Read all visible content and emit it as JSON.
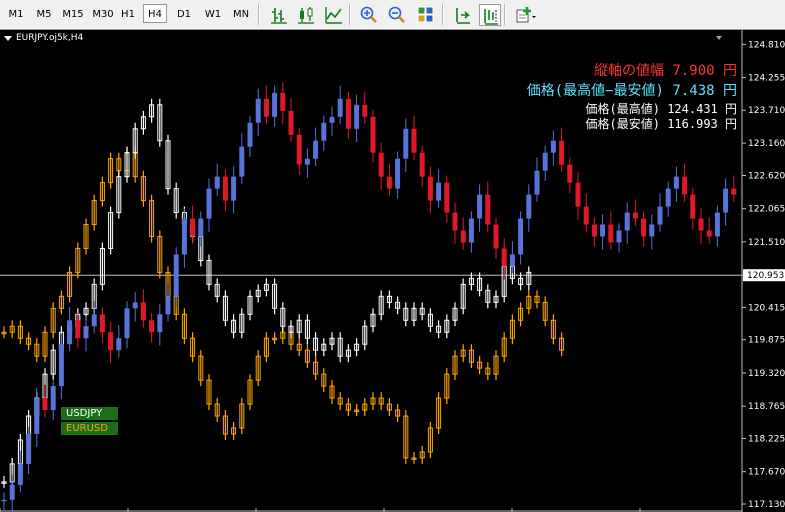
{
  "toolbar": {
    "timeframes": [
      {
        "label": "M1",
        "active": false
      },
      {
        "label": "M5",
        "active": false
      },
      {
        "label": "M15",
        "active": false
      },
      {
        "label": "M30",
        "active": false
      },
      {
        "label": "H1",
        "active": false
      },
      {
        "label": "H4",
        "active": true
      },
      {
        "label": "D1",
        "active": false
      },
      {
        "label": "W1",
        "active": false
      },
      {
        "label": "MN",
        "active": false
      }
    ],
    "tools": [
      {
        "name": "bar-chart-icon",
        "active": false
      },
      {
        "name": "candlestick-chart-icon",
        "active": false
      },
      {
        "name": "line-chart-icon",
        "active": false
      },
      {
        "name": "zoom-in-icon",
        "active": false
      },
      {
        "name": "zoom-out-icon",
        "active": false
      },
      {
        "name": "tile-windows-icon",
        "active": false
      },
      {
        "name": "auto-scroll-icon",
        "active": false
      },
      {
        "name": "chart-shift-icon",
        "active": true
      },
      {
        "name": "indicators-icon",
        "active": false
      }
    ]
  },
  "chart": {
    "symbol": "EURJPY.oj5k,H4",
    "current_price": "120.953",
    "price_axis": [
      "124.810",
      "124.255",
      "123.710",
      "123.160",
      "122.620",
      "122.065",
      "121.510",
      "120.953",
      "120.415",
      "119.875",
      "119.320",
      "118.765",
      "118.225",
      "117.670",
      "117.130"
    ],
    "colors": {
      "bull": "#5a73d9",
      "bear": "#e0182a",
      "price_line": "#c0c0c0",
      "eurusd_color": "#ffa500",
      "usdjpy_color": "#ffffff",
      "overlay_red": "#ff3333",
      "overlay_cyan": "#5ee0ff",
      "overlay_white": "#ffffff"
    },
    "overlays": [
      {
        "text": "縦軸の値幅 7.900 円",
        "color": "#ff3333"
      },
      {
        "text": "価格(最高値−最安値) 7.438 円",
        "color": "#5ee0ff"
      },
      {
        "text": "価格(最高値) 124.431 円",
        "color": "#ffffff"
      },
      {
        "text": "価格(最安値) 116.993 円",
        "color": "#ffffff"
      }
    ],
    "legend": [
      {
        "label": "USDJPY",
        "color": "#ffffff"
      },
      {
        "label": "EURUSD",
        "color": "#ffa500"
      }
    ]
  },
  "chart_data": {
    "type": "candlestick",
    "ylim": [
      117.13,
      124.85
    ],
    "series": [
      {
        "name": "EURJPY",
        "values": [
          117.2,
          117.45,
          117.8,
          118.3,
          118.9,
          118.7,
          119.1,
          119.8,
          120.2,
          119.9,
          120.1,
          120.3,
          120.0,
          119.7,
          119.9,
          120.4,
          120.5,
          120.2,
          120.0,
          120.3,
          120.6,
          121.3,
          121.9,
          121.6,
          121.9,
          122.4,
          122.6,
          122.2,
          122.6,
          123.1,
          123.5,
          123.9,
          123.6,
          124.0,
          123.7,
          123.3,
          122.8,
          122.9,
          123.2,
          123.5,
          123.6,
          123.9,
          123.4,
          123.8,
          123.6,
          123.0,
          122.6,
          122.4,
          122.9,
          123.4,
          123.0,
          122.6,
          122.2,
          122.5,
          122.0,
          121.7,
          121.5,
          121.9,
          122.3,
          121.8,
          121.4,
          121.1,
          121.3,
          121.9,
          122.3,
          122.7,
          123.0,
          123.2,
          122.8,
          122.5,
          122.1,
          121.8,
          121.6,
          121.8,
          121.5,
          121.7,
          122.0,
          121.9,
          121.6,
          121.8,
          122.1,
          122.4,
          122.6,
          122.3,
          121.9,
          121.7,
          121.6,
          122.0,
          122.4,
          122.3
        ]
      },
      {
        "name": "USDJPY",
        "values": [
          117.5,
          117.8,
          118.2,
          118.6,
          118.9,
          119.3,
          119.7,
          120.0,
          120.1,
          120.3,
          120.4,
          120.8,
          121.4,
          122.0,
          122.6,
          123.0,
          123.4,
          123.6,
          123.8,
          123.2,
          122.4,
          122.0,
          121.8,
          121.6,
          121.2,
          120.8,
          120.6,
          120.2,
          120.0,
          120.3,
          120.6,
          120.7,
          120.8,
          120.4,
          120.1,
          120.0,
          120.2,
          119.9,
          119.7,
          119.8,
          119.9,
          119.6,
          119.7,
          119.8,
          120.1,
          120.3,
          120.6,
          120.5,
          120.4,
          120.2,
          120.4,
          120.3,
          120.1,
          120.0,
          120.2,
          120.4,
          120.8,
          120.9,
          120.7,
          120.5,
          120.6,
          121.1,
          120.9,
          120.8,
          121.0
        ]
      },
      {
        "name": "EURUSD",
        "values": [
          120.0,
          120.1,
          119.9,
          119.8,
          119.6,
          120.0,
          120.4,
          120.6,
          121.0,
          121.4,
          121.8,
          122.2,
          122.5,
          122.9,
          122.7,
          123.0,
          122.6,
          122.2,
          121.6,
          121.0,
          120.6,
          120.3,
          119.9,
          119.6,
          119.2,
          118.8,
          118.6,
          118.3,
          118.4,
          118.8,
          119.2,
          119.6,
          119.9,
          119.9,
          120.0,
          119.8,
          119.7,
          119.5,
          119.3,
          119.1,
          118.9,
          118.8,
          118.7,
          118.7,
          118.8,
          118.9,
          118.8,
          118.7,
          118.6,
          117.9,
          117.9,
          118.0,
          118.4,
          118.9,
          119.3,
          119.6,
          119.7,
          119.5,
          119.4,
          119.3,
          119.6,
          119.9,
          120.2,
          120.4,
          120.6,
          120.5,
          120.2,
          119.9,
          119.7
        ]
      }
    ]
  }
}
